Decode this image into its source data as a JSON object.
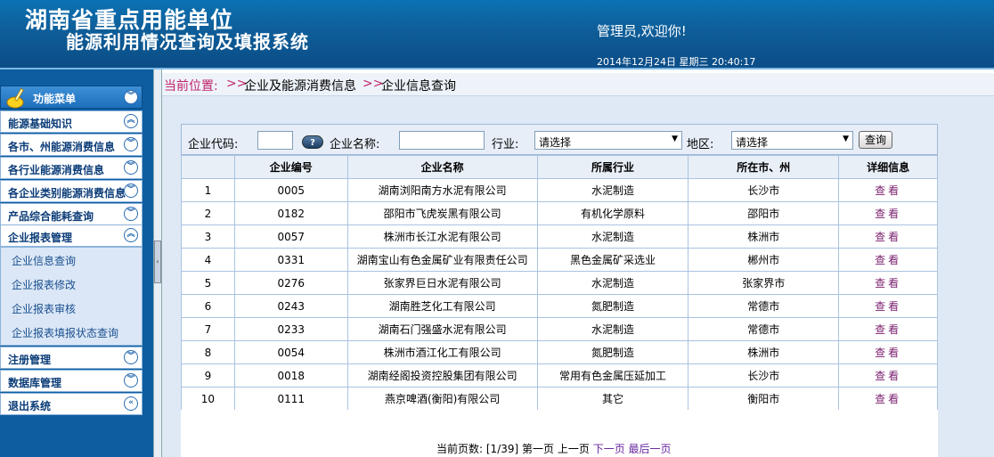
{
  "header": {
    "title_line1": "湖南省重点用能单位",
    "title_line2": "能源利用情况查询及填报系统",
    "welcome": "管理员,欢迎你!",
    "datetime": "2014年12月24日 星期三 20:40:17"
  },
  "sidebar": {
    "menu_title": "功能菜单",
    "items": [
      {
        "label": "能源基础知识",
        "chev": "︽"
      },
      {
        "label": "各市、州能源消费信息",
        "chev": "︾"
      },
      {
        "label": "各行业能源消费信息",
        "chev": "︾"
      },
      {
        "label": "各企业类别能源消费信息",
        "chev": "︾"
      },
      {
        "label": "产品综合能耗查询",
        "chev": "︾"
      },
      {
        "label": "企业报表管理",
        "chev": "︽"
      },
      {
        "label": "注册管理",
        "chev": "︾"
      },
      {
        "label": "数据库管理",
        "chev": "︾"
      },
      {
        "label": "退出系统",
        "chev": "«"
      }
    ],
    "subitems": [
      "企业信息查询",
      "企业报表修改",
      "企业报表审核",
      "企业报表填报状态查询"
    ]
  },
  "breadcrumb": {
    "current_label": "当前位置:",
    "sep": ">>",
    "level1": "企业及能源消费信息",
    "level2": "企业信息查询"
  },
  "search": {
    "code_label": "企业代码:",
    "help": "?",
    "name_label": "企业名称:",
    "industry_label": "行业:",
    "industry_value": "请选择",
    "region_label": "地区:",
    "region_value": "请选择",
    "query_button": "查询"
  },
  "table": {
    "headers": [
      "",
      "企业编号",
      "企业名称",
      "所属行业",
      "所在市、州",
      "详细信息"
    ],
    "rows": [
      [
        "1",
        "0005",
        "湖南浏阳南方水泥有限公司",
        "水泥制造",
        "长沙市",
        "查看"
      ],
      [
        "2",
        "0182",
        "邵阳市飞虎炭黑有限公司",
        "有机化学原料",
        "邵阳市",
        "查看"
      ],
      [
        "3",
        "0057",
        "株洲市长江水泥有限公司",
        "水泥制造",
        "株洲市",
        "查看"
      ],
      [
        "4",
        "0331",
        "湖南宝山有色金属矿业有限责任公司",
        "黑色金属矿采选业",
        "郴州市",
        "查看"
      ],
      [
        "5",
        "0276",
        "张家界巨日水泥有限公司",
        "水泥制造",
        "张家界市",
        "查看"
      ],
      [
        "6",
        "0243",
        "湖南胜芝化工有限公司",
        "氮肥制造",
        "常德市",
        "查看"
      ],
      [
        "7",
        "0233",
        "湖南石门强盛水泥有限公司",
        "水泥制造",
        "常德市",
        "查看"
      ],
      [
        "8",
        "0054",
        "株洲市酒江化工有限公司",
        "氮肥制造",
        "株洲市",
        "查看"
      ],
      [
        "9",
        "0018",
        "湖南经阁投资控股集团有限公司",
        "常用有色金属压延加工",
        "长沙市",
        "查看"
      ],
      [
        "10",
        "0111",
        "燕京啤酒(衡阳)有限公司",
        "其它",
        "衡阳市",
        "查看"
      ]
    ]
  },
  "pager": {
    "label": "当前页数:",
    "page_info": "[1/39]",
    "first": "第一页",
    "prev": "上一页",
    "next": "下一页",
    "last": "最后一页"
  },
  "colors": {
    "header_bg": "#0e5d98",
    "sidebar_bg": "#0d5da0",
    "breadcrumb_accent": "#c0246a",
    "link_purple": "#7a1f6e"
  }
}
